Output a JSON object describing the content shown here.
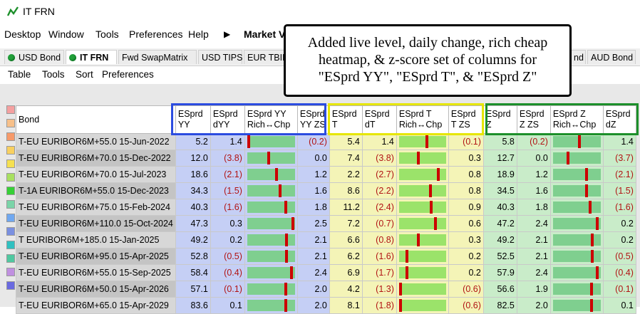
{
  "window": {
    "title": "IT FRN"
  },
  "menu": [
    "Desktop",
    "Window",
    "Tools",
    "Preferences",
    "Help",
    "▶",
    "Market V"
  ],
  "tabs": [
    "USD Bond",
    "IT FRN",
    "Fwd SwapMatrix",
    "USD TIPS",
    "EUR TBILL",
    "nd",
    "AUD Bond"
  ],
  "active_tab": "IT FRN",
  "submenu": [
    "Table",
    "Tools",
    "Sort",
    "Preferences"
  ],
  "callout": {
    "line1": "Added live level, daily change, rich cheap",
    "line2": "heatmap, & z-score set of columns for",
    "line3": "\"ESprd YY\", \"ESprd T\", & \"ESprd Z\""
  },
  "columns": {
    "bond": "Bond",
    "yy": {
      "level": [
        "ESprd",
        "YY"
      ],
      "chg": [
        "ESprd",
        "dYY"
      ],
      "rc": [
        "ESprd YY",
        "Rich↔Chp"
      ],
      "zs": [
        "ESprd",
        "YY ZS"
      ]
    },
    "t": {
      "level": [
        "ESprd",
        "T"
      ],
      "chg": [
        "ESprd",
        "dT"
      ],
      "rc": [
        "ESprd T",
        "Rich↔Chp"
      ],
      "zs": [
        "ESprd",
        "T ZS"
      ]
    },
    "z": {
      "level": [
        "ESprd",
        "Z"
      ],
      "chg": [
        "ESprd",
        "Z ZS"
      ],
      "rc": [
        "ESprd Z",
        "Rich↔Chp"
      ],
      "zs": [
        "ESprd",
        "dZ"
      ]
    }
  },
  "colors": {
    "yy_box": "#2b4ce0",
    "t_box": "#e6e600",
    "z_box": "#1c8f2a",
    "marker": "#cc0000",
    "negative": "#b11414"
  },
  "row_swatches": [
    "#f5a0a0",
    "#f7c08a",
    "#f79a6a",
    "#f8d060",
    "#f5e050",
    "#a8e060",
    "#36d036",
    "#7ad4a8",
    "#70a8f0",
    "#7a90e0",
    "#30c0c0",
    "#50c8a0",
    "#c090e0",
    "#6a6ae0"
  ],
  "rows": [
    {
      "bond": "T-EU EURIBOR6M+55.0 15-Jun-2022",
      "yy": "5.2",
      "dyy": "1.4",
      "yy_rc": 0.0,
      "yy_zs": "(0.2)",
      "t": "5.4",
      "dt": "1.4",
      "t_rc": 0.6,
      "t_zs": "(0.1)",
      "z": "5.8",
      "z_zs": "(0.2)",
      "z_rc": 0.55,
      "dz": "1.4"
    },
    {
      "bond": "T-EU EURIBOR6M+70.0 15-Dec-2022",
      "yy": "12.0",
      "dyy": "(3.8)",
      "yy_rc": 0.45,
      "yy_zs": "0.0",
      "t": "7.4",
      "dt": "(3.8)",
      "t_rc": 0.4,
      "t_zs": "0.3",
      "z": "12.7",
      "z_zs": "0.0",
      "z_rc": 0.3,
      "dz": "(3.7)"
    },
    {
      "bond": "T-EU EURIBOR6M+70.0 15-Jul-2023",
      "yy": "18.6",
      "dyy": "(2.1)",
      "yy_rc": 0.62,
      "yy_zs": "1.2",
      "t": "2.2",
      "dt": "(2.7)",
      "t_rc": 0.85,
      "t_zs": "0.8",
      "z": "18.9",
      "z_zs": "1.2",
      "z_rc": 0.72,
      "dz": "(2.1)"
    },
    {
      "bond": "T-1A EURIBOR6M+55.0 15-Dec-2023",
      "yy": "34.3",
      "dyy": "(1.5)",
      "yy_rc": 0.7,
      "yy_zs": "1.6",
      "t": "8.6",
      "dt": "(2.2)",
      "t_rc": 0.68,
      "t_zs": "0.8",
      "z": "34.5",
      "z_zs": "1.6",
      "z_rc": 0.72,
      "dz": "(1.5)"
    },
    {
      "bond": "T-EU EURIBOR6M+75.0 15-Feb-2024",
      "yy": "40.3",
      "dyy": "(1.6)",
      "yy_rc": 0.82,
      "yy_zs": "1.8",
      "t": "11.2",
      "dt": "(2.4)",
      "t_rc": 0.7,
      "t_zs": "0.9",
      "z": "40.3",
      "z_zs": "1.8",
      "z_rc": 0.8,
      "dz": "(1.6)"
    },
    {
      "bond": "T-EU EURIBOR6M+110.0 15-Oct-2024",
      "yy": "47.3",
      "dyy": "0.3",
      "yy_rc": 0.98,
      "yy_zs": "2.5",
      "t": "7.2",
      "dt": "(0.7)",
      "t_rc": 0.8,
      "t_zs": "0.6",
      "z": "47.2",
      "z_zs": "2.4",
      "z_rc": 0.95,
      "dz": "0.2"
    },
    {
      "bond": "T EURIBOR6M+185.0 15-Jan-2025",
      "yy": "49.2",
      "dyy": "0.2",
      "yy_rc": 0.85,
      "yy_zs": "2.1",
      "t": "6.6",
      "dt": "(0.8)",
      "t_rc": 0.4,
      "t_zs": "0.3",
      "z": "49.2",
      "z_zs": "2.1",
      "z_rc": 0.85,
      "dz": "0.2"
    },
    {
      "bond": "T-EU EURIBOR6M+95.0 15-Apr-2025",
      "yy": "52.8",
      "dyy": "(0.5)",
      "yy_rc": 0.85,
      "yy_zs": "2.1",
      "t": "6.2",
      "dt": "(1.6)",
      "t_rc": 0.15,
      "t_zs": "0.2",
      "z": "52.5",
      "z_zs": "2.1",
      "z_rc": 0.85,
      "dz": "(0.5)"
    },
    {
      "bond": "T-EU EURIBOR6M+55.0 15-Sep-2025",
      "yy": "58.4",
      "dyy": "(0.4)",
      "yy_rc": 0.95,
      "yy_zs": "2.4",
      "t": "6.9",
      "dt": "(1.7)",
      "t_rc": 0.15,
      "t_zs": "0.2",
      "z": "57.9",
      "z_zs": "2.4",
      "z_rc": 0.95,
      "dz": "(0.4)"
    },
    {
      "bond": "T-EU EURIBOR6M+50.0 15-Apr-2026",
      "yy": "57.1",
      "dyy": "(0.1)",
      "yy_rc": 0.82,
      "yy_zs": "2.0",
      "t": "4.2",
      "dt": "(1.3)",
      "t_rc": 0.0,
      "t_zs": "(0.6)",
      "z": "56.6",
      "z_zs": "1.9",
      "z_rc": 0.82,
      "dz": "(0.1)"
    },
    {
      "bond": "T-EU EURIBOR6M+65.0 15-Apr-2029",
      "yy": "83.6",
      "dyy": "0.1",
      "yy_rc": 0.82,
      "yy_zs": "2.0",
      "t": "8.1",
      "dt": "(1.8)",
      "t_rc": 0.0,
      "t_zs": "(0.6)",
      "z": "82.5",
      "z_zs": "2.0",
      "z_rc": 0.82,
      "dz": "0.1"
    }
  ]
}
